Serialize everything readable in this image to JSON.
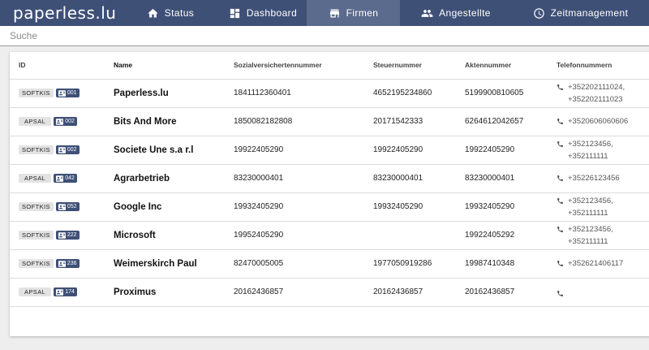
{
  "brand": "paperless.lu",
  "nav": [
    {
      "label": "Status",
      "icon": "home-icon"
    },
    {
      "label": "Dashboard",
      "icon": "dashboard-icon"
    },
    {
      "label": "Firmen",
      "icon": "store-icon",
      "active": true
    },
    {
      "label": "Angestellte",
      "icon": "people-icon"
    },
    {
      "label": "Zeitmanagement",
      "icon": "clock-icon"
    }
  ],
  "search": {
    "placeholder": "Suche"
  },
  "table": {
    "columns": [
      "ID",
      "Name",
      "Sozialversichertennummer",
      "Steuernummer",
      "Aktennummer",
      "Telefonnummern"
    ],
    "rows": [
      {
        "tag": "SOFTKIS",
        "num": "001",
        "name": "Paperless.lu",
        "sv": "1841112360401",
        "st": "4652195234860",
        "ak": "5199900810605",
        "tel": [
          "+352202111024,",
          "+352202111023"
        ]
      },
      {
        "tag": "APSAL",
        "num": "002",
        "name": "Bits And More",
        "sv": "1850082182808",
        "st": "20171542333",
        "ak": "6264612042657",
        "tel": [
          "+3520606060606"
        ]
      },
      {
        "tag": "SOFTKIS",
        "num": "002",
        "name": "Societe Une s.a r.l",
        "sv": "19922405290",
        "st": "19922405290",
        "ak": "19922405290",
        "tel": [
          "+352123456,",
          "+352111111"
        ]
      },
      {
        "tag": "APSAL",
        "num": "042",
        "name": "Agrarbetrieb",
        "sv": "83230000401",
        "st": "83230000401",
        "ak": "83230000401",
        "tel": [
          "+35226123456"
        ]
      },
      {
        "tag": "SOFTKIS",
        "num": "052",
        "name": "Google Inc",
        "sv": "19932405290",
        "st": "19932405290",
        "ak": "19932405290",
        "tel": [
          "+352123456,",
          "+352111111"
        ]
      },
      {
        "tag": "SOFTKIS",
        "num": "222",
        "name": "Microsoft",
        "sv": "19952405290",
        "st": "",
        "ak": "19922405292",
        "tel": [
          "+352123456,",
          "+352111111"
        ]
      },
      {
        "tag": "SOFTKIS",
        "num": "236",
        "name": "Weimerskirch Paul",
        "sv": "82470005005",
        "st": "1977050919286",
        "ak": "19987410348",
        "tel": [
          "+352621406117"
        ]
      },
      {
        "tag": "APSAL",
        "num": "174",
        "name": "Proximus",
        "sv": "20162436857",
        "st": "20162436857",
        "ak": "20162436857",
        "tel": []
      }
    ]
  },
  "colors": {
    "primary": "#3f5077",
    "active_tab": "#5b6b8d"
  }
}
